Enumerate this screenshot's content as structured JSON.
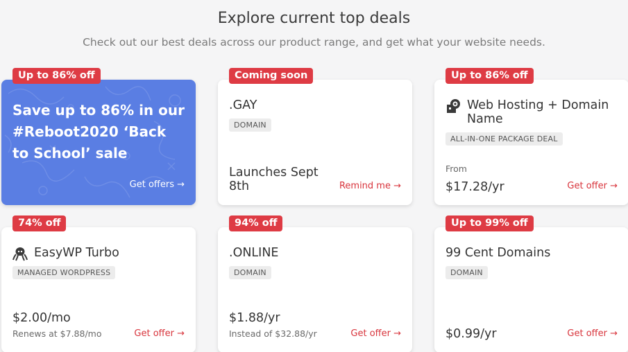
{
  "header": {
    "title": "Explore current top deals",
    "subtitle": "Check out our best deals across our product range, and get what your website needs."
  },
  "colors": {
    "accent": "#de3b44",
    "hero_bg": "#5a7ee3",
    "link": "#d8333b"
  },
  "deals": {
    "hero": {
      "badge": "Up to 86% off",
      "text": "Save up to 86% in our #Reboot2020 ‘Back to School’ sale",
      "cta": "Get offers →"
    },
    "gay": {
      "badge": "Coming soon",
      "title": ".GAY",
      "tag": "DOMAIN",
      "price": "Launches Sept 8th",
      "cta": "Remind me →"
    },
    "hosting": {
      "badge": "Up to 86% off",
      "icon": "hosting-icon",
      "title": "Web Hosting + Domain Name",
      "tag": "ALL-IN-ONE PACKAGE DEAL",
      "from": "From",
      "price": "$17.28/yr",
      "cta": "Get offer →"
    },
    "easywp": {
      "badge": "74% off",
      "icon": "octopus-icon",
      "title": "EasyWP Turbo",
      "tag": "MANAGED WORDPRESS",
      "price": "$2.00/mo",
      "note": "Renews at $7.88/mo",
      "cta": "Get offer →"
    },
    "online": {
      "badge": "94% off",
      "title": ".ONLINE",
      "tag": "DOMAIN",
      "price": "$1.88/yr",
      "note": "Instead of $32.88/yr",
      "cta": "Get offer →"
    },
    "cent": {
      "badge": "Up to 99% off",
      "title": "99 Cent Domains",
      "tag": "DOMAIN",
      "price": "$0.99/yr",
      "cta": "Get offer →"
    }
  }
}
